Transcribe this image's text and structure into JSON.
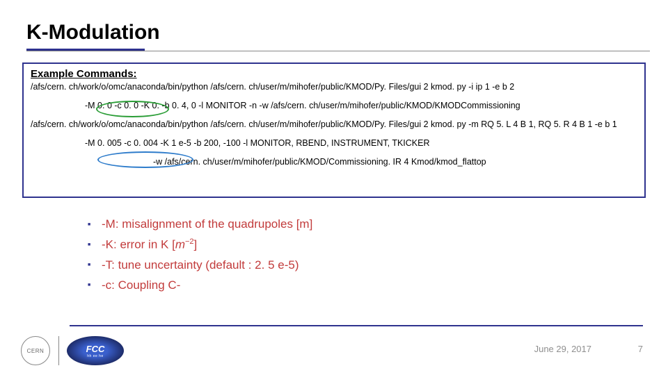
{
  "title": "K-Modulation",
  "box": {
    "subhead": "Example Commands:",
    "line1": "/afs/cern. ch/work/o/omc/anaconda/bin/python /afs/cern. ch/user/m/mihofer/public/KMOD/Py. Files/gui 2 kmod. py -i ip 1 -e b 2",
    "line2": "-M 0. 0 -c 0. 0 -K 0.  -b 0. 4, 0 -l MONITOR  -n -w /afs/cern. ch/user/m/mihofer/public/KMOD/KMODCommissioning",
    "line3": "/afs/cern. ch/work/o/omc/anaconda/bin/python /afs/cern. ch/user/m/mihofer/public/KMOD/Py. Files/gui 2 kmod. py -m RQ 5. L 4 B 1, RQ 5. R 4 B 1 -e b 1",
    "line4": "-M 0. 005 -c 0. 004 -K 1 e-5 -b 200, -100 -l MONITOR, RBEND, INSTRUMENT, TKICKER",
    "line5": "-w /afs/cern. ch/user/m/mihofer/public/KMOD/Commissioning. IR 4 Kmod/kmod_flattop"
  },
  "bullets": {
    "b1": "-M: misalignment of the quadrupoles [m]",
    "b2_pre": "-K: error in K [",
    "b2_sup": "−2",
    "b2_post": "]",
    "b3": "-T: tune uncertainty (default : 2. 5 e-5)",
    "b4": "-c: Coupling C-"
  },
  "footer": {
    "cern": "CERN",
    "fcc": "FCC",
    "fcc_small": "hh ee he",
    "date": "June 29, 2017",
    "page": "7"
  }
}
